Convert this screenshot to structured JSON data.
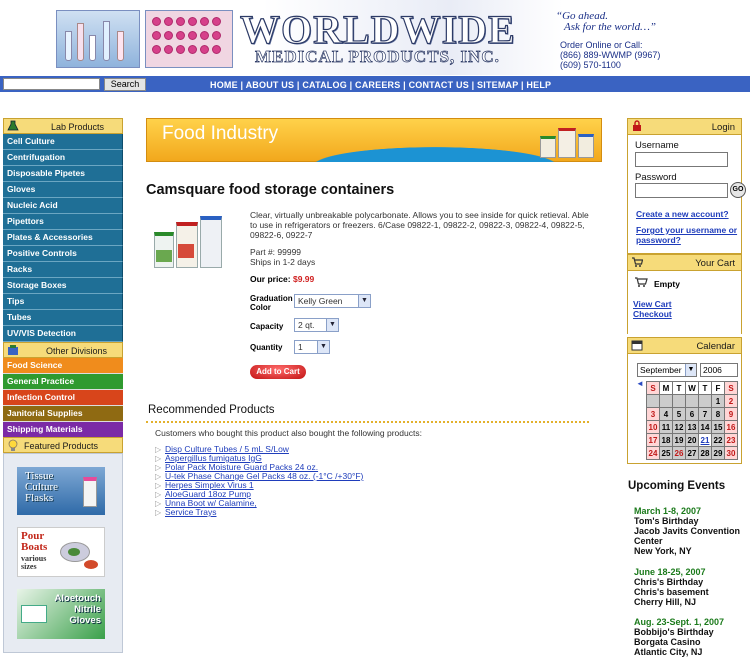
{
  "header": {
    "logo_line1": "WORLDWIDE",
    "logo_line2": "MEDICAL PRODUCTS, INC.",
    "slogan_line1": "“Go ahead.",
    "slogan_line2": "Ask for the world…”",
    "contact_line1": "Order Online or Call:",
    "contact_line2": "(866) 889-WWMP (9967)",
    "contact_line3": "(609) 570-1100"
  },
  "search": {
    "button": "Search",
    "value": ""
  },
  "nav": {
    "links": [
      "HOME",
      "ABOUT US",
      "CATALOG",
      "CAREERS",
      "CONTACT US",
      "SITEMAP",
      "HELP"
    ],
    "separator": " | "
  },
  "left": {
    "lab_products_title": "Lab Products",
    "lab_products": [
      "Cell Culture",
      "Centrifugation",
      "Disposable Pipetes",
      "Gloves",
      "Nucleic Acid",
      "Pipettors",
      "Plates & Accessories",
      "Positive Controls",
      "Racks",
      "Storage Boxes",
      "Tips",
      "Tubes",
      "UV/VIS Detection"
    ],
    "other_divisions_title": "Other Divisions",
    "other_divisions": [
      {
        "label": "Food Science",
        "color": "#f08c1c"
      },
      {
        "label": "General Practice",
        "color": "#2f9a2f"
      },
      {
        "label": "Infection Control",
        "color": "#d8451b"
      },
      {
        "label": "Janitorial Supplies",
        "color": "#8f6a12"
      },
      {
        "label": "Shipping Materials",
        "color": "#7b2aa6"
      }
    ],
    "featured_title": "Featured Products",
    "featured": [
      {
        "line1": "Tissue",
        "line2": "Culture",
        "line3": "Flasks"
      },
      {
        "line1": "Pour",
        "line2": "Boats",
        "line3": "various",
        "line4": "sizes"
      },
      {
        "line1": "Aloetouch",
        "line2": "Nitrile",
        "line3": "Gloves"
      }
    ]
  },
  "main": {
    "banner": "Food Industry",
    "title": "Camsquare food storage containers",
    "description": "Clear, virtually unbreakable polycarbonate. Allows you to see inside for quick retieval. Able to use in refrigerators or freezers. 6/Case 09822-1, 09822-2, 09822-3, 09822-4, 09822-5, 09822-6, 0922-7",
    "part": "Part #: 99999",
    "ships": "Ships in 1-2 days",
    "price_label": "Our price: ",
    "price": "$9.99",
    "options": {
      "graduation_label_1": "Graduation",
      "graduation_label_2": "Color",
      "graduation_value": "Kelly Green",
      "capacity_label": "Capacity",
      "capacity_value": "2 qt.",
      "quantity_label": "Quantity",
      "quantity_value": "1"
    },
    "add_to_cart": "Add to Cart",
    "recommended_title": "Recommended Products",
    "recommended_intro": "Customers who bought this product also bought the following products:",
    "recommended": [
      "Disp Culture Tubes / 5 mL S/Low",
      "Aspergillus fumigatus IgG",
      "Polar Pack Moisture Guard Packs 24 oz.",
      "U-tek Phase Change Gel Packs 48 oz. (-1°C /+30°F)",
      "Herpes Simplex Virus 1",
      "AloeGuard 18oz Pump",
      "Unna Boot w/ Calamine,",
      "Service Trays"
    ]
  },
  "right": {
    "login_title": "Login",
    "username_label": "Username",
    "password_label": "Password",
    "go": "GO",
    "create_account": "Create a new account?",
    "forgot_1": "Forgot your username or",
    "forgot_2": "password?",
    "cart_title": "Your Cart",
    "cart_status": "Empty",
    "view_cart": "View Cart",
    "checkout": "Checkout",
    "calendar_title": "Calendar",
    "month": "September",
    "year": "2006",
    "weekdays": [
      "S",
      "M",
      "T",
      "W",
      "T",
      "F",
      "S"
    ],
    "weeks": [
      [
        "",
        "",
        "",
        "",
        "",
        "1",
        "2"
      ],
      [
        "3",
        "4",
        "5",
        "6",
        "7",
        "8",
        "9"
      ],
      [
        "10",
        "11",
        "12",
        "13",
        "14",
        "15",
        "16"
      ],
      [
        "17",
        "18",
        "19",
        "20",
        "21",
        "22",
        "23"
      ],
      [
        "24",
        "25",
        "26",
        "27",
        "28",
        "29",
        "30"
      ]
    ],
    "events_title": "Upcoming Events",
    "events": [
      {
        "date": "March 1-8, 2007",
        "lines": [
          "Tom's Birthday",
          "Jacob Javits Convention",
          "Center",
          "New York, NY"
        ]
      },
      {
        "date": "June 18-25, 2007",
        "lines": [
          "Chris's Birthday",
          "Chris's basement",
          "Cherry Hill, NJ"
        ]
      },
      {
        "date": "Aug. 23-Sept. 1, 2007",
        "lines": [
          "Bobbijo's Birthday",
          "Borgata Casino",
          "Atlantic City, NJ"
        ]
      }
    ]
  }
}
